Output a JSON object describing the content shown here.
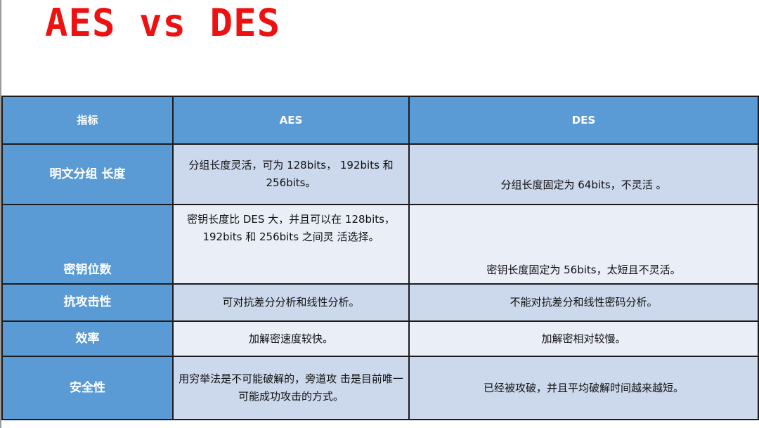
{
  "title": "AES vs DES",
  "header": {
    "col0": "指标",
    "col1": "AES",
    "col2": "DES"
  },
  "rows": [
    {
      "label": "明文分组 长度",
      "aes": "分组长度灵活，可为 128bits， 192bits 和 256bits。",
      "des": "分组长度固定为 64bits，不灵活 。"
    },
    {
      "label": "密钥位数",
      "aes": "密钥长度比 DES 大，并且可以在 128bits，192bits 和 256bits 之间灵 活选择。",
      "des": "密钥长度固定为 56bits，太短且不灵活。"
    },
    {
      "label": "抗攻击性",
      "aes": "可对抗差分分析和线性分析。",
      "des": "不能对抗差分和线性密码分析。"
    },
    {
      "label": "效率",
      "aes": "加解密速度较快。",
      "des": "加解密相对较慢。"
    },
    {
      "label": "安全性",
      "aes": "用穷举法是不可能破解的，旁道攻 击是目前唯一可能成功攻击的方式。",
      "des": "已经被攻破，并且平均破解时间越来越短。"
    }
  ],
  "colors": {
    "title": "#ee1111",
    "header_bg": "#5b9bd5",
    "row_dark": "#ccd8ec",
    "row_light": "#e9eef7"
  }
}
